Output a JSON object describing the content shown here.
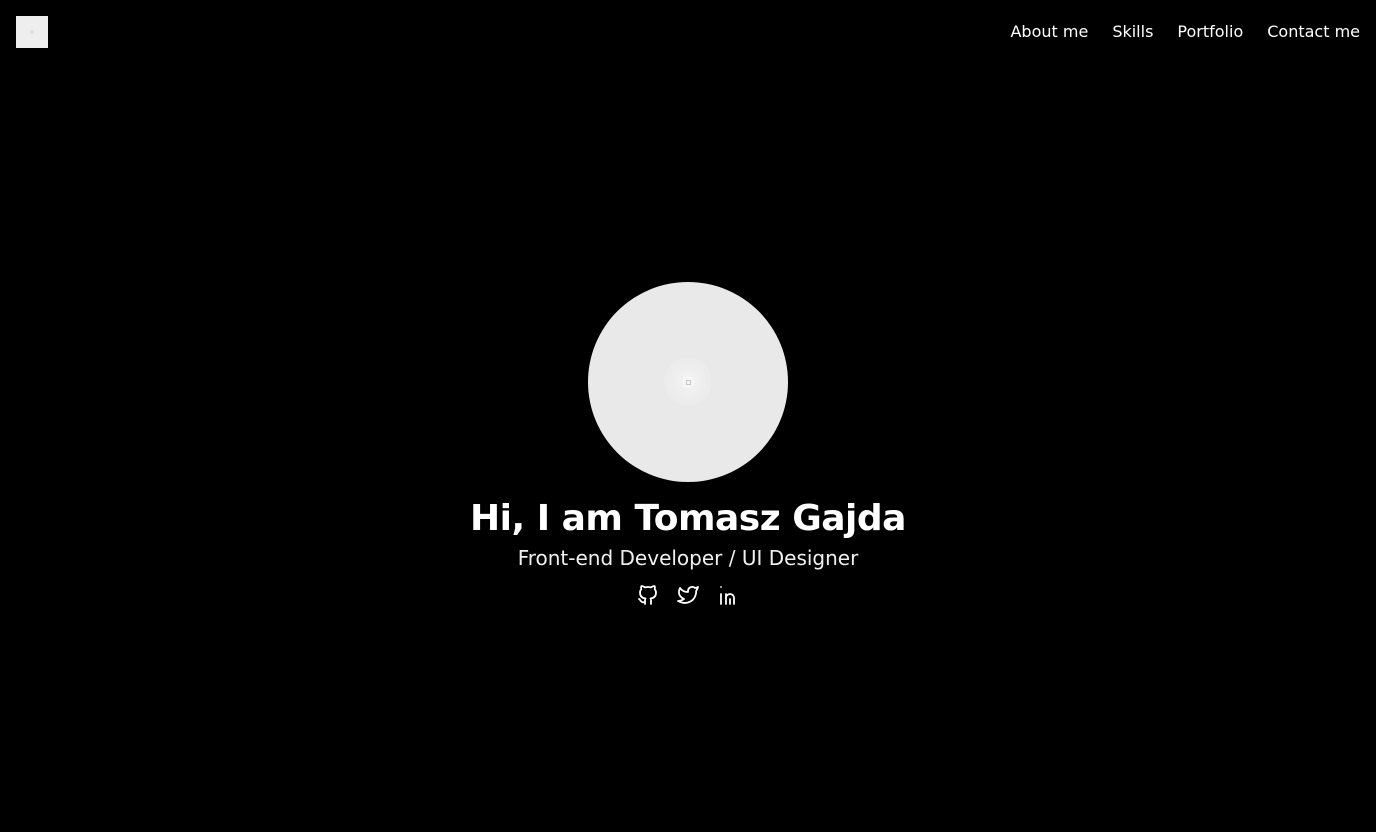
{
  "header": {
    "logo_icon": "logo-image-placeholder-icon",
    "nav": [
      {
        "label": "About me"
      },
      {
        "label": "Skills"
      },
      {
        "label": "Portfolio"
      },
      {
        "label": "Contact me"
      }
    ]
  },
  "hero": {
    "avatar_icon": "image-placeholder-icon",
    "title": "Hi, I am Tomasz Gajda",
    "subtitle": "Front-end Developer / UI Designer",
    "social": [
      {
        "icon": "github-icon"
      },
      {
        "icon": "twitter-icon"
      },
      {
        "icon": "linkedin-icon"
      }
    ]
  },
  "colors": {
    "background": "#000000",
    "text": "#ffffff",
    "avatar": "#e9e9e9"
  }
}
